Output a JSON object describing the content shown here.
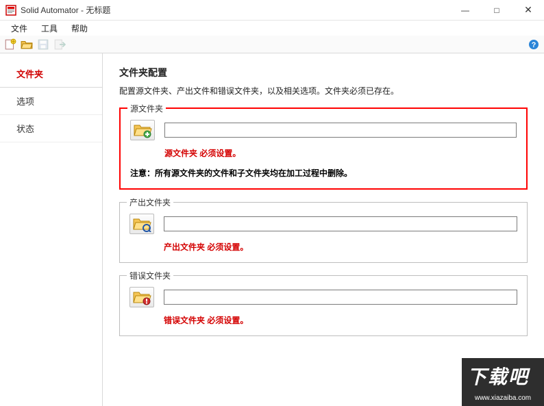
{
  "window": {
    "title": "Solid Automator - 无标题",
    "minimize": "—",
    "maximize": "□",
    "close": "✕"
  },
  "menu": {
    "file": "文件",
    "tools": "工具",
    "help": "帮助"
  },
  "sidebar": {
    "items": [
      {
        "label": "文件夹"
      },
      {
        "label": "选项"
      },
      {
        "label": "状态"
      }
    ]
  },
  "main": {
    "heading": "文件夹配置",
    "description": "配置源文件夹、产出文件和错误文件夹，以及相关选项。文件夹必须已存在。"
  },
  "groups": {
    "source": {
      "legend": "源文件夹",
      "path": "",
      "warn": "源文件夹 必须设置。",
      "note": "注意：所有源文件夹的文件和子文件夹均在加工过程中删除。"
    },
    "output": {
      "legend": "产出文件夹",
      "path": "",
      "warn": "产出文件夹 必须设置。"
    },
    "error": {
      "legend": "错误文件夹",
      "path": "",
      "warn": "错误文件夹 必须设置。"
    }
  },
  "watermark": {
    "line1": "下载吧",
    "line2": "www.xiazaiba.com"
  }
}
